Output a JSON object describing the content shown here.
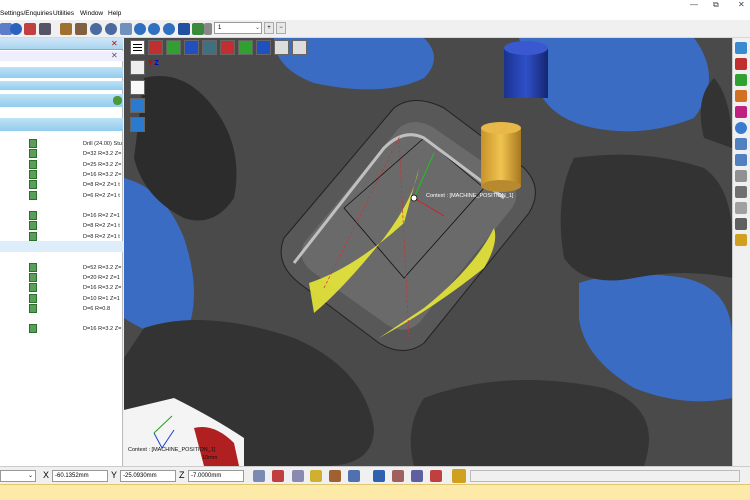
{
  "menu": {
    "items": [
      "Settings/Enquiries",
      "Utilities",
      "Window",
      "Help"
    ]
  },
  "window_controls": {
    "minimize": "—",
    "restore": "⧉",
    "close": "✕"
  },
  "toolbar": {
    "combo_value": "1",
    "combo_arrow": "⌄",
    "plus": "+",
    "minus": "−"
  },
  "operations": [
    {
      "label": "Drill (24.00) Stu",
      "row": 0
    },
    {
      "label": "D=32 R=3.2 Z=",
      "row": 1
    },
    {
      "label": "D=25 R=3.2 Z=",
      "row": 2
    },
    {
      "label": "D=16 R=3.2 Z=",
      "row": 3
    },
    {
      "label": "D=8 R=2 Z=1 t",
      "row": 4
    },
    {
      "label": "D=6 R=2 Z=1 t",
      "row": 5
    },
    {
      "label": "D=16 R=2 Z=1",
      "row": 7
    },
    {
      "label": "D=8 R=2 Z=1 t",
      "row": 8
    },
    {
      "label": "D=8 R=2 Z=1 t",
      "row": 9
    },
    {
      "label": "D=52 R=3.2 Z=",
      "row": 12
    },
    {
      "label": "D=20 R=2 Z=1",
      "row": 13
    },
    {
      "label": "D=16 R=3.2 Z=",
      "row": 14
    },
    {
      "label": "D=10 R=1 Z=1",
      "row": 15
    },
    {
      "label": "D=6 R=0.8",
      "row": 16
    },
    {
      "label": "D=16 R=3.2 Z=",
      "row": 18
    }
  ],
  "viewport": {
    "context_label": "Context : [MACHINE_POSITION_1]",
    "context_label_bottom": "Context : [MACHINE_POSITION_1]",
    "scale_label": "10mm",
    "axis_y": "Y",
    "axis_z": "Z",
    "axis_x": "X"
  },
  "status": {
    "x_label": "X",
    "x_value": "-60.1352mm",
    "y_label": "Y",
    "y_value": "-25.0930mm",
    "z_label": "Z",
    "z_value": "-7.0000mm"
  },
  "colors": {
    "plate": "#4a4a4a",
    "pocket_floor": "#6a6a6a",
    "blue_bg": "#3b6cc4",
    "toolpath": "#e8e838",
    "tool_holder": "#1f3ea8",
    "tool_shank": "#d8a83a"
  }
}
